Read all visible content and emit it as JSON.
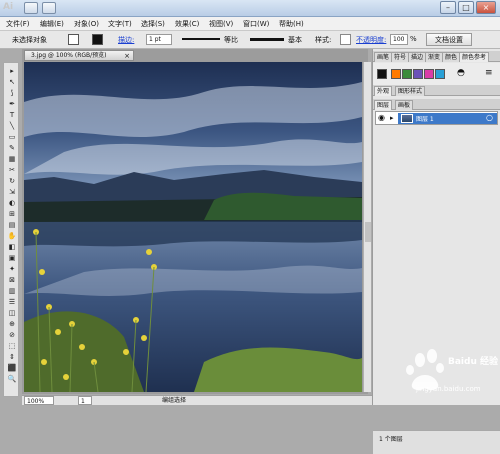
{
  "app": {
    "logo": "Ai",
    "window_controls": [
      "–",
      "□",
      "×"
    ]
  },
  "menu": [
    "文件(F)",
    "编辑(E)",
    "对象(O)",
    "文字(T)",
    "选择(S)",
    "效果(C)",
    "视图(V)",
    "窗口(W)",
    "帮助(H)"
  ],
  "options": {
    "selection": "未选择对象",
    "stroke_label": "描边:",
    "stroke_weight": "1 pt",
    "stroke_style": "等比",
    "brush_style": "基本",
    "style_label": "样式:",
    "opacity_label": "不透明度:",
    "opacity_value": "100",
    "opacity_unit": "%",
    "doc_settings": "文档设置"
  },
  "tools": [
    "▸",
    "↖",
    "⟆",
    "✒",
    "T",
    "╲",
    "▭",
    "✎",
    "▦",
    "✂",
    "↻",
    "⇲",
    "◐",
    "⊞",
    "▤",
    "✋",
    "◧",
    "▣",
    "✦",
    "⊠",
    "▥",
    "☰",
    "◫",
    "⊕",
    "⊘",
    "⬚",
    "⇕",
    "⬛",
    "🔍"
  ],
  "document": {
    "tab_title": "3.jpg @ 100% (RGB/预览)"
  },
  "status": {
    "zoom": "100%",
    "page": "1",
    "selection_mode": "编组选择"
  },
  "panels": {
    "top_tabs": [
      "画笔",
      "符号",
      "描边",
      "渐变",
      "颜色",
      "颜色参考"
    ],
    "mid_tabs": [
      "外观",
      "图形样式"
    ],
    "layers_tabs": [
      "图层",
      "画板"
    ],
    "layer_name": "图层 1",
    "layer_count": "1 个图层"
  },
  "watermark": {
    "brand": "Baidu 经验",
    "url": "jingyan.baidu.com"
  },
  "colors": {
    "titlebar": "#c6d7ec",
    "selection": "#3d79c9",
    "link": "#1a3fd1",
    "swatches": [
      "#ff7a00",
      "#3b8c3a",
      "#6b51b8",
      "#d93da8",
      "#29a0d6"
    ]
  }
}
